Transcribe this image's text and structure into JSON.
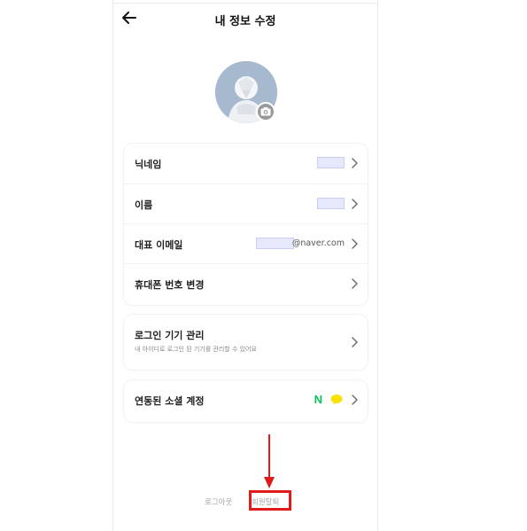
{
  "header": {
    "title": "내 정보 수정",
    "back_icon": "arrow-left-icon"
  },
  "profile": {
    "avatar_icon": "default-avatar-icon",
    "camera_icon": "camera-icon",
    "avatar_bg": "#a6b9cf"
  },
  "account_rows": [
    {
      "label": "닉네임",
      "value_masked": true
    },
    {
      "label": "이름",
      "value_masked": true
    },
    {
      "label": "대표 이메일",
      "value_masked": true,
      "email_domain": "@naver.com"
    },
    {
      "label": "휴대폰 번호 변경"
    }
  ],
  "device": {
    "title": "로그인 기기 관리",
    "subtitle": "내 아이디로 로그인 된 기기를 관리할 수 있어요"
  },
  "social": {
    "label": "연동된 소셜 계정",
    "naver_text": "N",
    "naver_color": "#03c75a",
    "kakao_color": "#fae100",
    "kakao_icon": "kakao-talk-icon"
  },
  "footer": {
    "logout": "로그아웃",
    "withdraw": "회원탈퇴"
  },
  "annotation": {
    "highlight_color": "#e01b1b"
  }
}
